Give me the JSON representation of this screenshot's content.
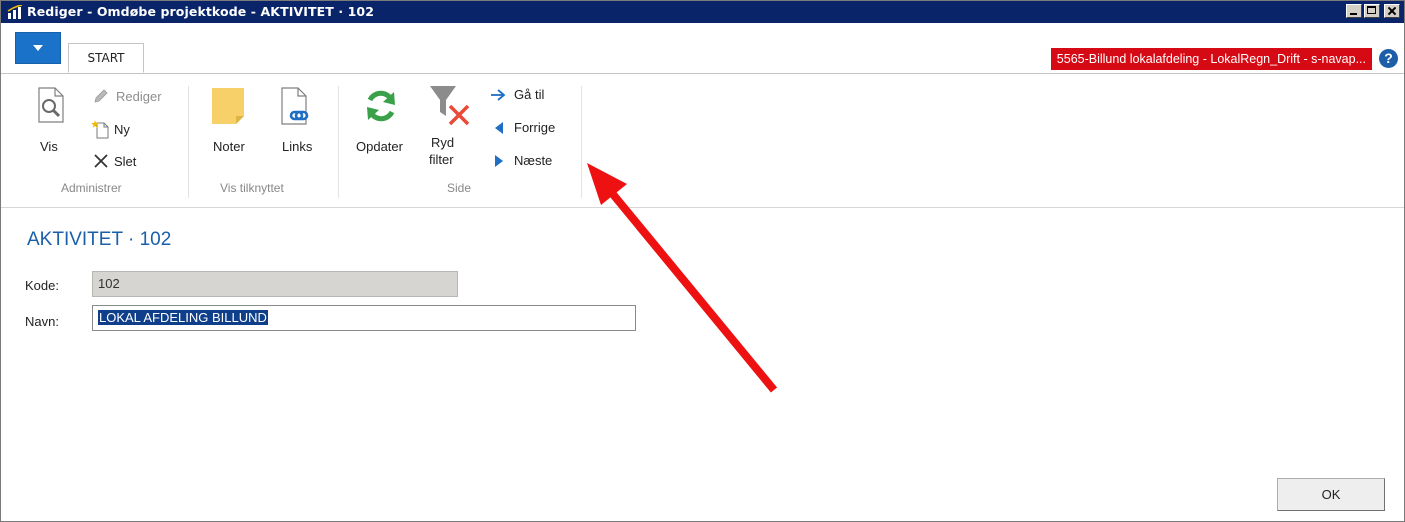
{
  "window": {
    "title": "Rediger - Omdøbe projektkode - AKTIVITET · 102"
  },
  "tabs": {
    "start_label": "START"
  },
  "company_badge": {
    "text": "5565-Billund lokalafdeling - LokalRegn_Drift - s-navap...",
    "color": "#d60a14"
  },
  "help": {
    "label": "?"
  },
  "ribbon": {
    "groups": {
      "administrer": {
        "label": "Administrer",
        "vis": "Vis",
        "rediger": "Rediger",
        "ny": "Ny",
        "slet": "Slet"
      },
      "vis_tilknyttet": {
        "label": "Vis tilknyttet",
        "noter": "Noter",
        "links": "Links"
      },
      "side": {
        "label": "Side",
        "opdater": "Opdater",
        "ryd_filter_line1": "Ryd",
        "ryd_filter_line2": "filter",
        "gaa_til": "Gå til",
        "forrige": "Forrige",
        "naeste": "Næste"
      }
    }
  },
  "page": {
    "title": "AKTIVITET · 102",
    "fields": {
      "kode_label": "Kode:",
      "kode_value": "102",
      "navn_label": "Navn:",
      "navn_value": "LOKAL AFDELING  BILLUND"
    },
    "ok_label": "OK"
  },
  "colors": {
    "accent": "#1a73c8",
    "title_text": "#1a5fa8",
    "annotation_arrow": "#ee1111"
  },
  "icons": {
    "vis": "magnifier-page-icon",
    "rediger": "pencil-icon",
    "ny": "new-page-icon",
    "slet": "x-delete-icon",
    "noter": "sticky-note-icon",
    "links": "link-page-icon",
    "opdater": "refresh-icon",
    "ryd_filter": "clear-filter-icon",
    "gaa_til": "arrow-right-icon",
    "forrige": "triangle-left-icon",
    "naeste": "triangle-right-icon"
  }
}
